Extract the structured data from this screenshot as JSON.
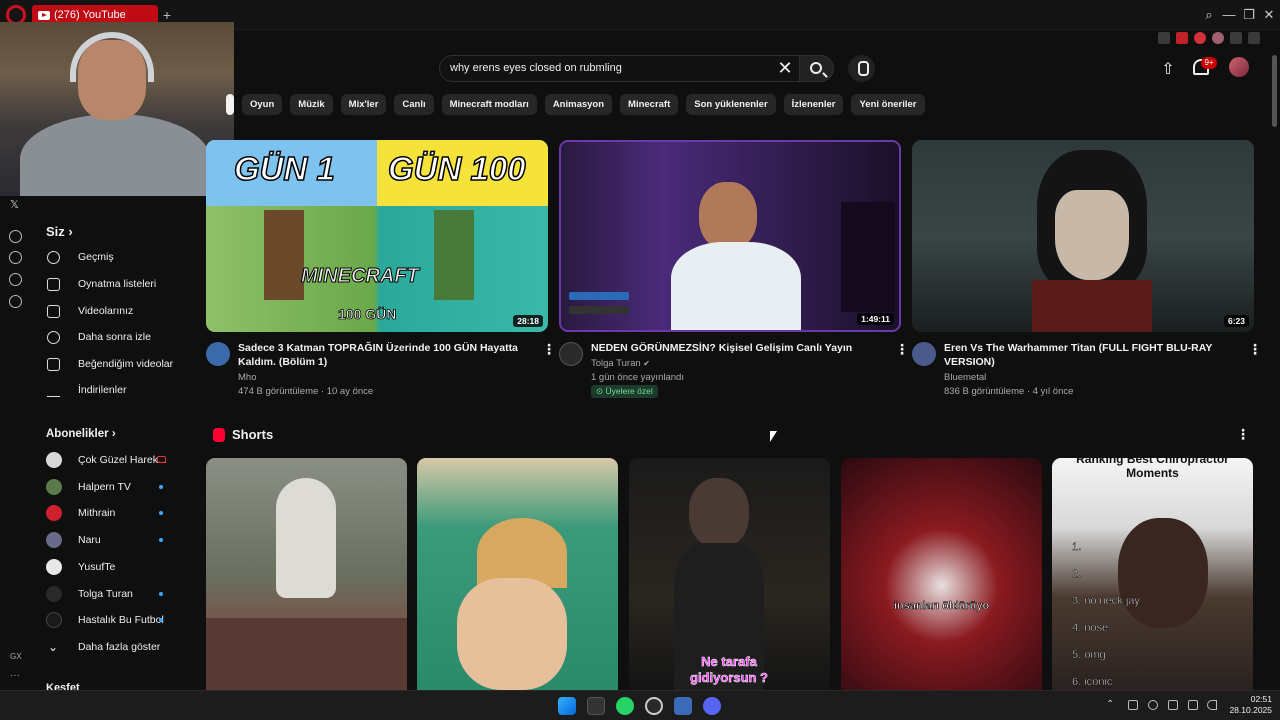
{
  "browser": {
    "tab_title": "(276) YouTube",
    "new_tab": "+",
    "window_min": "—",
    "window_max": "❐",
    "window_close": "✕"
  },
  "search": {
    "query": "why erens eyes closed on rubmling",
    "clear": "✕"
  },
  "header": {
    "notification_count": "9+"
  },
  "chips": [
    "Oyun",
    "Müzik",
    "Mix'ler",
    "Canlı",
    "Minecraft modları",
    "Animasyon",
    "Minecraft",
    "Son yüklenenler",
    "İzlenenler",
    "Yeni öneriler"
  ],
  "sidebar": {
    "you_label": "Siz",
    "you_items": [
      "Geçmiş",
      "Oynatma listeleri",
      "Videolarınız",
      "Daha sonra izle",
      "Beğendiğim videolar",
      "İndirilenler"
    ],
    "subs_label": "Abonelikler",
    "subs_items": [
      "Çok Güzel Harek...",
      "Halpern TV",
      "Mithrain",
      "Naru",
      "YusufTe",
      "Tolga Turan",
      "Hastalık Bu Futbol"
    ],
    "show_more": "Daha fazla göster",
    "explore_label": "Keşfet"
  },
  "videos": [
    {
      "title": "Sadece 3 Katman TOPRAĞIN Üzerinde 100 GÜN Hayatta Kaldım. (Bölüm 1)",
      "channel": "Mho",
      "meta": "474 B görüntüleme · 10 ay önce",
      "duration": "28:18",
      "thumb_text_left": "GÜN 1",
      "thumb_text_right": "GÜN 100",
      "thumb_logo": "MINECRAFT",
      "thumb_sub": "100 GÜN"
    },
    {
      "title": "NEDEN GÖRÜNMEZSİN? Kişisel Gelişim Canlı Yayın",
      "channel": "Tolga Turan",
      "meta": "1 gün önce yayınlandı",
      "badge": "Üyelere özel",
      "duration": "1:49:11"
    },
    {
      "title": "Eren Vs The Warhammer Titan (FULL FIGHT BLU-RAY VERSION)",
      "channel": "Bluemetal",
      "meta": "836 B görüntüleme · 4 yıl önce",
      "duration": "6:23"
    }
  ],
  "shorts": {
    "label": "Shorts",
    "captions": [
      "",
      "",
      "Ne tarafa gidiyorsun ?",
      "insanları öldürüyo",
      "Ranking Best Chiropractor Moments"
    ],
    "list5": [
      "1.",
      "2.",
      "3. no neck jay",
      "4. nose",
      "5. omg",
      "6. iconic"
    ]
  },
  "taskbar": {
    "time": "02:51",
    "date": "28.10.2025"
  },
  "colors": {
    "brand_red": "#ff0033",
    "accent_blue": "#3ea6ff",
    "bg": "#0f0f0f"
  }
}
